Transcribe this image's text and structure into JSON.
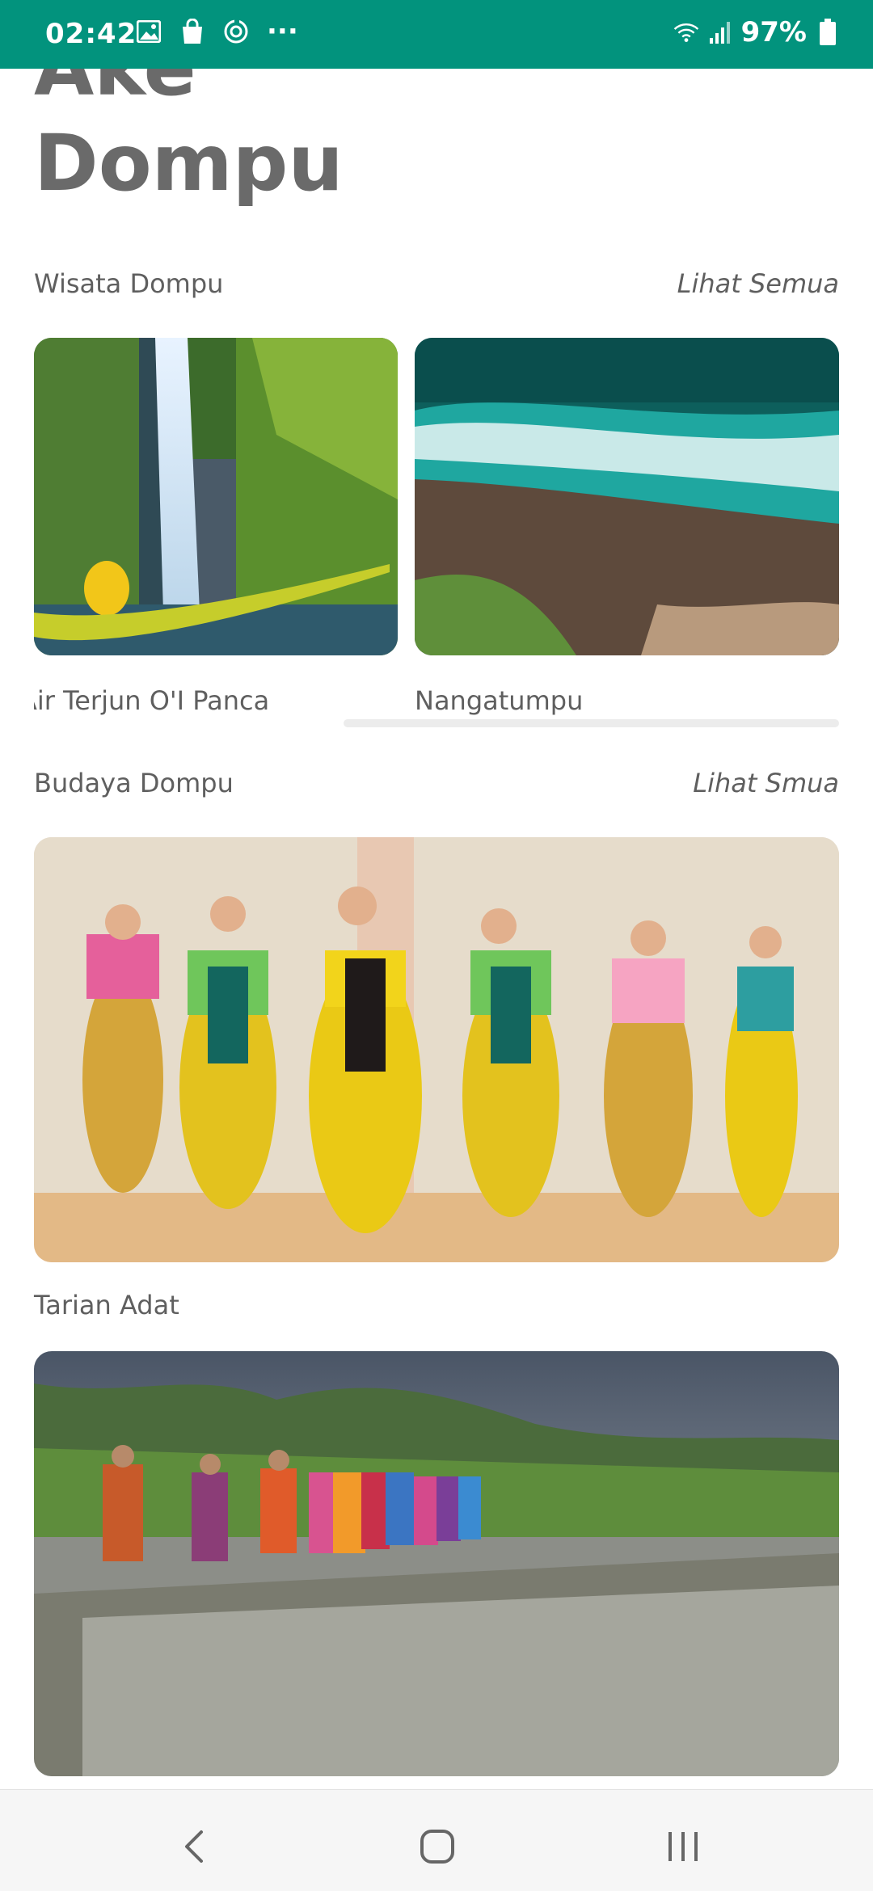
{
  "status_bar": {
    "time": "02:42",
    "battery_percent": "97%",
    "overflow": "···",
    "background_color": "#02937d",
    "icons": [
      "gallery-icon",
      "shopping-bag-icon",
      "sync-icon",
      "wifi-icon",
      "signal-icon",
      "battery-icon"
    ]
  },
  "page": {
    "title_line1": "Ake",
    "title_line2": "Dompu"
  },
  "wisata": {
    "heading": "Wisata Dompu",
    "see_all": "Lihat Semua",
    "cards": [
      {
        "label": "Air Terjun O'I Panca"
      },
      {
        "label": "Nangatumpu"
      }
    ]
  },
  "budaya": {
    "heading": "Budaya Dompu",
    "see_all": "Lihat Smua",
    "items": [
      {
        "label": "Tarian Adat"
      },
      {
        "label": ""
      }
    ]
  },
  "nav": {
    "back": "back",
    "home": "home",
    "recents": "recents"
  }
}
